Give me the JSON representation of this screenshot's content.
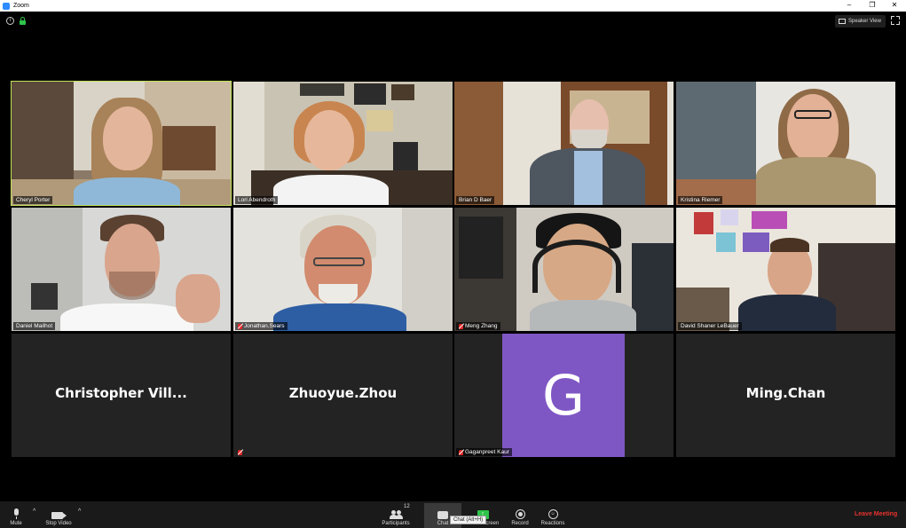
{
  "window": {
    "title": "Zoom",
    "minimize": "–",
    "restore": "❐",
    "close": "✕"
  },
  "top_bar": {
    "info_glyph": "i",
    "view_button": "Speaker View"
  },
  "participants": [
    {
      "name": "Cheryl Porter",
      "muted": false,
      "active_speaker": true
    },
    {
      "name": "Lori Abendroth",
      "muted": false
    },
    {
      "name": "Brian D Baer",
      "muted": false
    },
    {
      "name": "Kristina Riemer",
      "muted": false
    },
    {
      "name": "Daniel Mailhot",
      "muted": false
    },
    {
      "name": "Jonathan.Sears",
      "muted": true
    },
    {
      "name": "Meng Zhang",
      "muted": true
    },
    {
      "name": "David Shaner LeBauer",
      "muted": false
    },
    {
      "display_name": "Christopher  Vill...",
      "video": false,
      "muted": false
    },
    {
      "display_name": "Zhuoyue.Zhou",
      "video": false,
      "muted": true
    },
    {
      "name": "Gaganpreet Kaur",
      "avatar_letter": "G",
      "avatar_color": "#7f57c4",
      "video": false,
      "muted": true
    },
    {
      "display_name": "Ming.Chan",
      "video": false,
      "muted": false
    }
  ],
  "toolbar": {
    "mute": "Mute",
    "stop_video": "Stop Video",
    "caret": "^",
    "participants": "Participants",
    "participants_count": "12",
    "chat": "Chat",
    "share_screen": "Share Screen",
    "record": "Record",
    "reactions": "Reactions",
    "leave": "Leave Meeting",
    "chat_tooltip": "Chat (Alt+H)"
  },
  "colors": {
    "active_speaker": "#c2e25a",
    "leave": "#e8322e",
    "share": "#2ec44a"
  }
}
